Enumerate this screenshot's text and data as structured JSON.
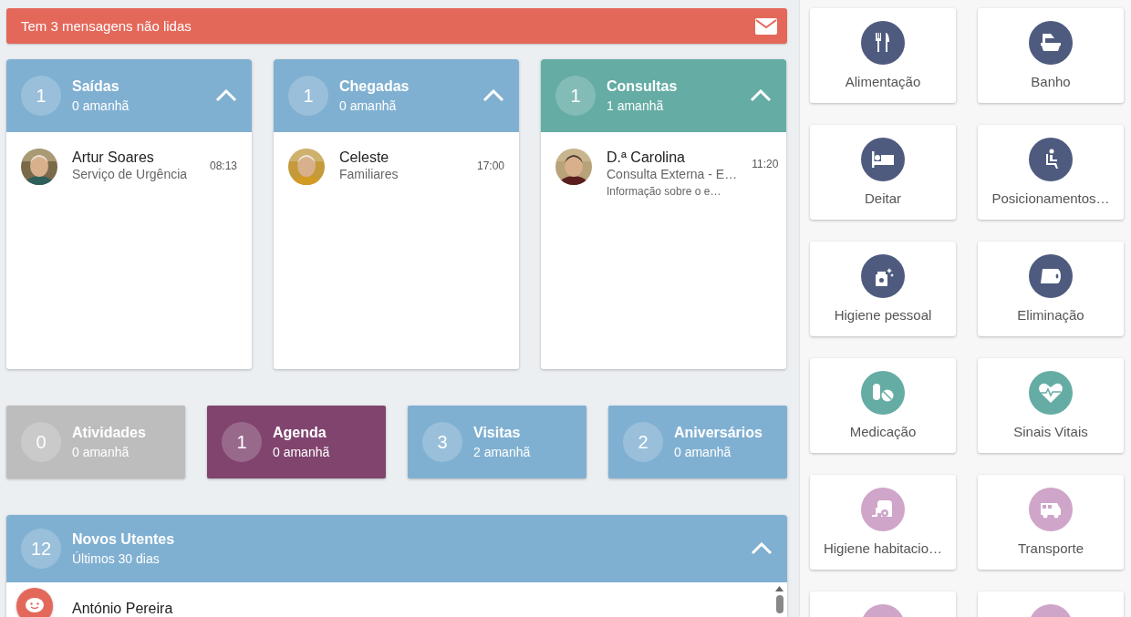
{
  "banner": {
    "text": "Tem 3 mensagens não lidas"
  },
  "panels": [
    {
      "count": "1",
      "title": "Saídas",
      "subtitle": "0 amanhã",
      "color": "#80b0d1",
      "expanded": true,
      "items": [
        {
          "name": "Artur Soares",
          "detail": "Serviço de Urgência",
          "time": "08:13"
        }
      ]
    },
    {
      "count": "1",
      "title": "Chegadas",
      "subtitle": "0 amanhã",
      "color": "#80b0d1",
      "expanded": true,
      "items": [
        {
          "name": "Celeste",
          "detail": "Familiares",
          "time": "17:00"
        }
      ]
    },
    {
      "count": "1",
      "title": "Consultas",
      "subtitle": "1 amanhã",
      "color": "#65aca4",
      "expanded": true,
      "items": [
        {
          "name": "D.ª Carolina",
          "detail": "Consulta Externa - E…",
          "note": "Informação sobre o e…",
          "time": "11:20"
        }
      ]
    }
  ],
  "summaries": [
    {
      "count": "0",
      "title": "Atividades",
      "subtitle": "0 amanhã",
      "color": "#bdbdbd"
    },
    {
      "count": "1",
      "title": "Agenda",
      "subtitle": "0 amanhã",
      "color": "#80446e"
    },
    {
      "count": "3",
      "title": "Visitas",
      "subtitle": "2 amanhã",
      "color": "#80b0d1"
    },
    {
      "count": "2",
      "title": "Aniversários",
      "subtitle": "0 amanhã",
      "color": "#80b0d1"
    }
  ],
  "new_residents": {
    "count": "12",
    "title": "Novos Utentes",
    "subtitle": "Últimos 30 dias",
    "expanded": true,
    "items": [
      {
        "name": "António Pereira"
      }
    ]
  },
  "tiles": [
    {
      "label": "Alimentação",
      "color": "#4f5b7e"
    },
    {
      "label": "Banho",
      "color": "#4f5b7e"
    },
    {
      "label": "Deitar",
      "color": "#4f5b7e"
    },
    {
      "label": "Posicionamentos…",
      "color": "#4f5b7e"
    },
    {
      "label": "Higiene pessoal",
      "color": "#4f5b7e"
    },
    {
      "label": "Eliminação",
      "color": "#4f5b7e"
    },
    {
      "label": "Medicação",
      "color": "#65aca4"
    },
    {
      "label": "Sinais Vitais",
      "color": "#65aca4"
    },
    {
      "label": "Higiene habitacio…",
      "color": "#cfa5c9"
    },
    {
      "label": "Transporte",
      "color": "#cfa5c9"
    },
    {
      "color": "#cfa5c9"
    },
    {
      "color": "#cfa5c9"
    }
  ]
}
